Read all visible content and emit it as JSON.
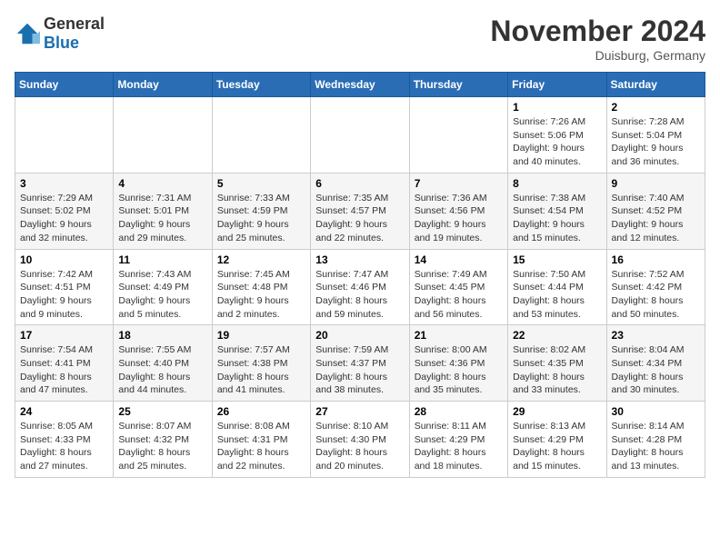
{
  "header": {
    "logo_general": "General",
    "logo_blue": "Blue",
    "month_title": "November 2024",
    "location": "Duisburg, Germany"
  },
  "weekdays": [
    "Sunday",
    "Monday",
    "Tuesday",
    "Wednesday",
    "Thursday",
    "Friday",
    "Saturday"
  ],
  "weeks": [
    [
      {
        "day": "",
        "info": ""
      },
      {
        "day": "",
        "info": ""
      },
      {
        "day": "",
        "info": ""
      },
      {
        "day": "",
        "info": ""
      },
      {
        "day": "",
        "info": ""
      },
      {
        "day": "1",
        "info": "Sunrise: 7:26 AM\nSunset: 5:06 PM\nDaylight: 9 hours\nand 40 minutes."
      },
      {
        "day": "2",
        "info": "Sunrise: 7:28 AM\nSunset: 5:04 PM\nDaylight: 9 hours\nand 36 minutes."
      }
    ],
    [
      {
        "day": "3",
        "info": "Sunrise: 7:29 AM\nSunset: 5:02 PM\nDaylight: 9 hours\nand 32 minutes."
      },
      {
        "day": "4",
        "info": "Sunrise: 7:31 AM\nSunset: 5:01 PM\nDaylight: 9 hours\nand 29 minutes."
      },
      {
        "day": "5",
        "info": "Sunrise: 7:33 AM\nSunset: 4:59 PM\nDaylight: 9 hours\nand 25 minutes."
      },
      {
        "day": "6",
        "info": "Sunrise: 7:35 AM\nSunset: 4:57 PM\nDaylight: 9 hours\nand 22 minutes."
      },
      {
        "day": "7",
        "info": "Sunrise: 7:36 AM\nSunset: 4:56 PM\nDaylight: 9 hours\nand 19 minutes."
      },
      {
        "day": "8",
        "info": "Sunrise: 7:38 AM\nSunset: 4:54 PM\nDaylight: 9 hours\nand 15 minutes."
      },
      {
        "day": "9",
        "info": "Sunrise: 7:40 AM\nSunset: 4:52 PM\nDaylight: 9 hours\nand 12 minutes."
      }
    ],
    [
      {
        "day": "10",
        "info": "Sunrise: 7:42 AM\nSunset: 4:51 PM\nDaylight: 9 hours\nand 9 minutes."
      },
      {
        "day": "11",
        "info": "Sunrise: 7:43 AM\nSunset: 4:49 PM\nDaylight: 9 hours\nand 5 minutes."
      },
      {
        "day": "12",
        "info": "Sunrise: 7:45 AM\nSunset: 4:48 PM\nDaylight: 9 hours\nand 2 minutes."
      },
      {
        "day": "13",
        "info": "Sunrise: 7:47 AM\nSunset: 4:46 PM\nDaylight: 8 hours\nand 59 minutes."
      },
      {
        "day": "14",
        "info": "Sunrise: 7:49 AM\nSunset: 4:45 PM\nDaylight: 8 hours\nand 56 minutes."
      },
      {
        "day": "15",
        "info": "Sunrise: 7:50 AM\nSunset: 4:44 PM\nDaylight: 8 hours\nand 53 minutes."
      },
      {
        "day": "16",
        "info": "Sunrise: 7:52 AM\nSunset: 4:42 PM\nDaylight: 8 hours\nand 50 minutes."
      }
    ],
    [
      {
        "day": "17",
        "info": "Sunrise: 7:54 AM\nSunset: 4:41 PM\nDaylight: 8 hours\nand 47 minutes."
      },
      {
        "day": "18",
        "info": "Sunrise: 7:55 AM\nSunset: 4:40 PM\nDaylight: 8 hours\nand 44 minutes."
      },
      {
        "day": "19",
        "info": "Sunrise: 7:57 AM\nSunset: 4:38 PM\nDaylight: 8 hours\nand 41 minutes."
      },
      {
        "day": "20",
        "info": "Sunrise: 7:59 AM\nSunset: 4:37 PM\nDaylight: 8 hours\nand 38 minutes."
      },
      {
        "day": "21",
        "info": "Sunrise: 8:00 AM\nSunset: 4:36 PM\nDaylight: 8 hours\nand 35 minutes."
      },
      {
        "day": "22",
        "info": "Sunrise: 8:02 AM\nSunset: 4:35 PM\nDaylight: 8 hours\nand 33 minutes."
      },
      {
        "day": "23",
        "info": "Sunrise: 8:04 AM\nSunset: 4:34 PM\nDaylight: 8 hours\nand 30 minutes."
      }
    ],
    [
      {
        "day": "24",
        "info": "Sunrise: 8:05 AM\nSunset: 4:33 PM\nDaylight: 8 hours\nand 27 minutes."
      },
      {
        "day": "25",
        "info": "Sunrise: 8:07 AM\nSunset: 4:32 PM\nDaylight: 8 hours\nand 25 minutes."
      },
      {
        "day": "26",
        "info": "Sunrise: 8:08 AM\nSunset: 4:31 PM\nDaylight: 8 hours\nand 22 minutes."
      },
      {
        "day": "27",
        "info": "Sunrise: 8:10 AM\nSunset: 4:30 PM\nDaylight: 8 hours\nand 20 minutes."
      },
      {
        "day": "28",
        "info": "Sunrise: 8:11 AM\nSunset: 4:29 PM\nDaylight: 8 hours\nand 18 minutes."
      },
      {
        "day": "29",
        "info": "Sunrise: 8:13 AM\nSunset: 4:29 PM\nDaylight: 8 hours\nand 15 minutes."
      },
      {
        "day": "30",
        "info": "Sunrise: 8:14 AM\nSunset: 4:28 PM\nDaylight: 8 hours\nand 13 minutes."
      }
    ]
  ]
}
